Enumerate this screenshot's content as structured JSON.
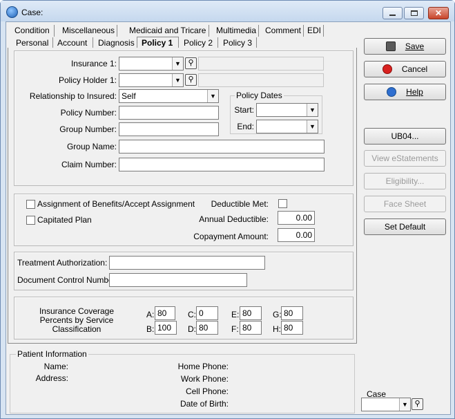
{
  "window": {
    "title": "Case:"
  },
  "tabs_row1": [
    "Condition",
    "Miscellaneous",
    "Medicaid and Tricare",
    "Multimedia",
    "Comment",
    "EDI"
  ],
  "tabs_row2": [
    "Personal",
    "Account",
    "Diagnosis",
    "Policy 1",
    "Policy 2",
    "Policy 3"
  ],
  "active_tab": "Policy 1",
  "policy": {
    "insurance1_label": "Insurance 1:",
    "insurance1_value": "",
    "policy_holder_label": "Policy Holder 1:",
    "policy_holder_value": "",
    "relationship_label": "Relationship to Insured:",
    "relationship_value": "Self",
    "policy_number_label": "Policy Number:",
    "group_number_label": "Group Number:",
    "group_name_label": "Group Name:",
    "claim_number_label": "Claim Number:",
    "policy_dates_title": "Policy Dates",
    "start_label": "Start:",
    "end_label": "End:"
  },
  "benefits": {
    "assignment_label": "Assignment of Benefits/Accept Assignment",
    "capitated_label": "Capitated Plan",
    "deductible_met_label": "Deductible Met:",
    "annual_deductible_label": "Annual Deductible:",
    "annual_deductible_value": "0.00",
    "copayment_label": "Copayment Amount:",
    "copayment_value": "0.00"
  },
  "authorization": {
    "treatment_label": "Treatment Authorization:",
    "doc_control_label": "Document Control Number:"
  },
  "coverage": {
    "title": "Insurance Coverage Percents by Service Classification",
    "A": "80",
    "B": "100",
    "C": "0",
    "D": "80",
    "E": "80",
    "F": "80",
    "G": "80",
    "H": "80",
    "labels": {
      "A": "A:",
      "B": "B:",
      "C": "C:",
      "D": "D:",
      "E": "E:",
      "F": "F:",
      "G": "G:",
      "H": "H:"
    }
  },
  "patient": {
    "title": "Patient Information",
    "name_label": "Name:",
    "address_label": "Address:",
    "home_phone_label": "Home Phone:",
    "work_phone_label": "Work Phone:",
    "cell_phone_label": "Cell Phone:",
    "dob_label": "Date of Birth:"
  },
  "buttons": {
    "save": "Save",
    "cancel": "Cancel",
    "help": "Help",
    "ub04": "UB04...",
    "view_estatements": "View eStatements",
    "eligibility": "Eligibility...",
    "face_sheet": "Face Sheet",
    "set_default": "Set Default"
  },
  "case_selector": {
    "label": "Case",
    "value": ""
  },
  "colors": {
    "save_icon": "#3a3a3a",
    "cancel_icon": "#d8211f",
    "help_icon": "#2f6fd0"
  }
}
